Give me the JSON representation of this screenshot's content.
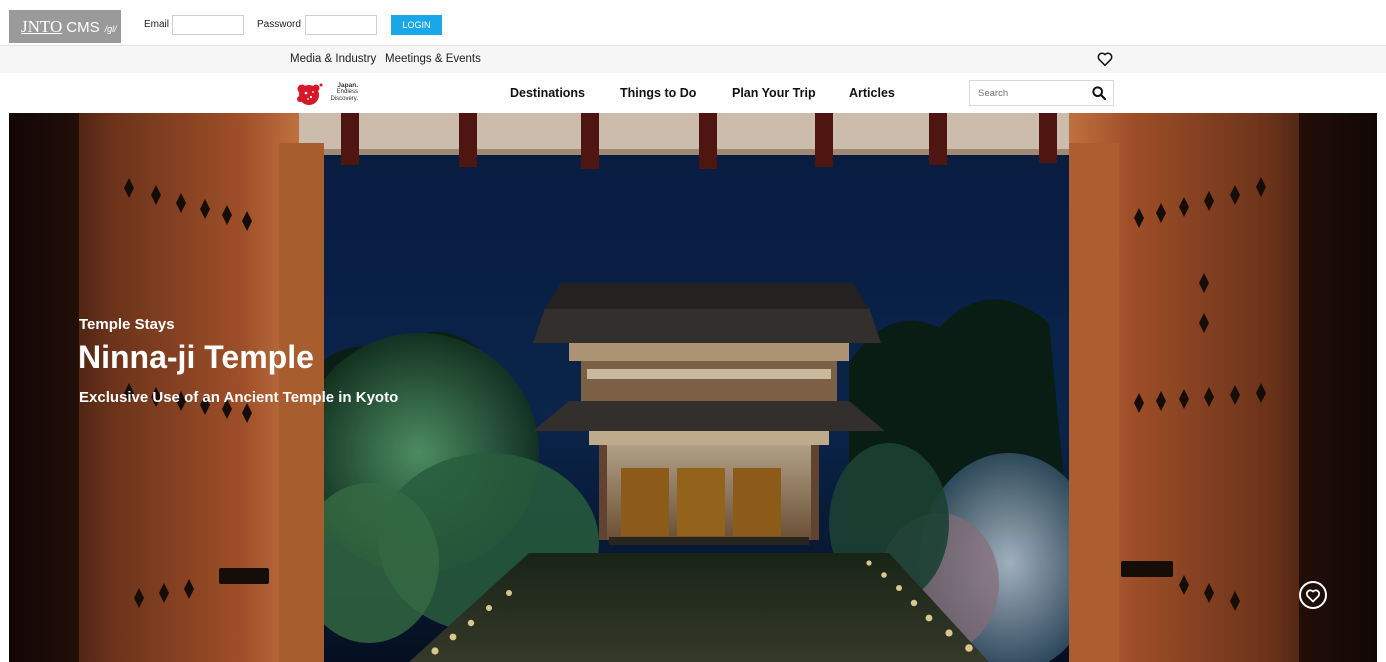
{
  "cms": {
    "logo_main": "JNTO",
    "logo_cms": "CMS",
    "logo_env": "/gl/",
    "email_label": "Email",
    "email_value": "",
    "password_label": "Password",
    "password_value": "",
    "login_label": "LOGIN"
  },
  "utility": {
    "links": [
      "Media & Industry",
      "Meetings & Events"
    ],
    "favorites_icon": "heart-outline-icon"
  },
  "nav": {
    "brand_line1": "Japan.",
    "brand_line2": "Endless",
    "brand_line3": "Discovery.",
    "items": [
      "Destinations",
      "Things to Do",
      "Plan Your Trip",
      "Articles"
    ],
    "search_placeholder": "Search",
    "search_icon": "search-icon"
  },
  "hero": {
    "category": "Temple Stays",
    "title": "Ninna-ji Temple",
    "subtitle": "Exclusive Use of an Ancient Temple in Kyoto",
    "favorite_icon": "heart-circle-icon"
  },
  "colors": {
    "login_button": "#1aa7ea",
    "cms_logo_bg": "#9a9a9a",
    "utility_bg": "#f6f6f6",
    "brand_red": "#d7182a"
  }
}
